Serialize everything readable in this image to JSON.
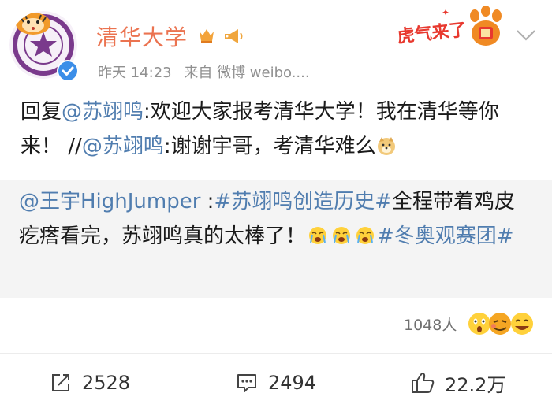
{
  "header": {
    "account_name": "清华大学",
    "time": "昨天 14:23",
    "source": "来自 微博 weibo....",
    "sticker_text": "虎气来了"
  },
  "post": {
    "reply_prefix": "回复",
    "mention1": "@苏翊鸣",
    "text1": ":欢迎大家报考清华大学！我在清华等你来！",
    "slashes": "//",
    "mention2": "@苏翊鸣",
    "text2": ":谢谢宇哥，考清华难么"
  },
  "repost": {
    "mention": "@王宇HighJumper",
    "sep": " :",
    "hashtag1": "#苏翊鸣创造历史#",
    "text": "全程带着鸡皮疙瘩看完，苏翊鸣真的太棒了！",
    "hashtag2": "#冬奥观赛团#"
  },
  "reactions": {
    "count": "1048人"
  },
  "actions": {
    "repost_count": "2528",
    "comment_count": "2494",
    "like_count": "22.2万"
  },
  "colors": {
    "name": "#eb7350",
    "link": "#507daf",
    "repost_bg": "#f4f4f4",
    "meta": "#909090"
  }
}
